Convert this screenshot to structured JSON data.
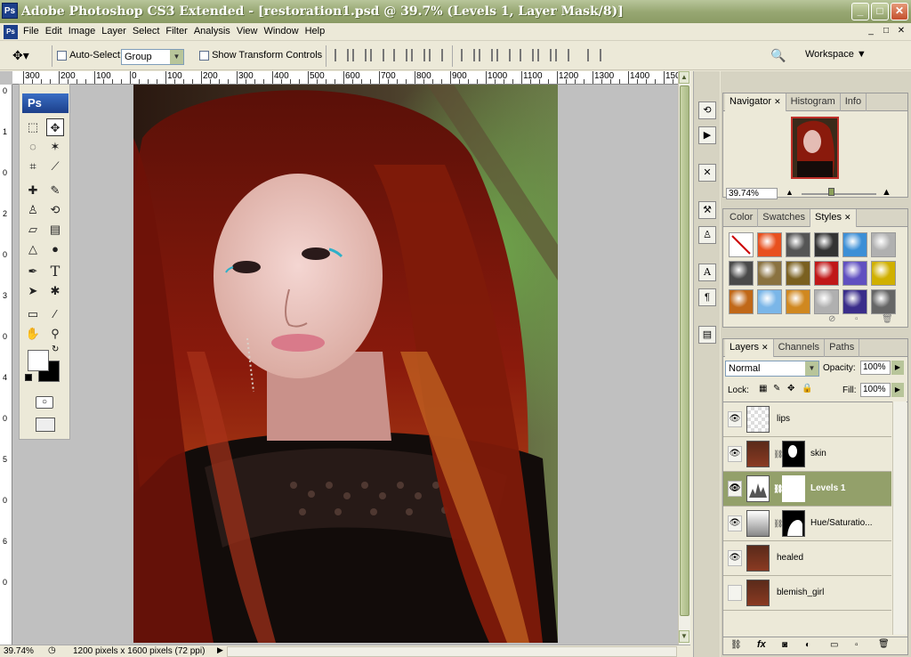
{
  "window": {
    "title": "Adobe Photoshop CS3 Extended - [restoration1.psd @ 39.7% (Levels 1, Layer Mask/8)]",
    "app_icon": "Ps",
    "minimize": "_",
    "maximize": "□",
    "close": "✕"
  },
  "menubar": {
    "items": [
      "File",
      "Edit",
      "Image",
      "Layer",
      "Select",
      "Filter",
      "Analysis",
      "View",
      "Window",
      "Help"
    ],
    "doc_controls": [
      "_",
      "□",
      "✕"
    ]
  },
  "options": {
    "auto_select_label": "Auto-Select:",
    "auto_select_value": "Group",
    "show_transform_label": "Show Transform Controls",
    "workspace_label": "Workspace"
  },
  "ruler": {
    "top_labels": [
      "300",
      "200",
      "100",
      "0",
      "100",
      "200",
      "300",
      "400",
      "500",
      "600",
      "700",
      "800",
      "900",
      "1000",
      "1100",
      "1200",
      "1300",
      "1400",
      "150"
    ],
    "left_labels": [
      "0",
      "1",
      "0",
      "2",
      "0",
      "3",
      "0",
      "4",
      "0",
      "5",
      "0",
      "6",
      "0"
    ]
  },
  "tools": {
    "logo": "Ps",
    "icons": [
      "marquee-icon",
      "move-icon",
      "lasso-icon",
      "magic-wand-icon",
      "crop-icon",
      "slice-icon",
      "healing-brush-icon",
      "brush-icon",
      "clone-stamp-icon",
      "history-brush-icon",
      "eraser-icon",
      "gradient-icon",
      "blur-icon",
      "dodge-icon",
      "pen-icon",
      "type-icon",
      "path-selection-icon",
      "shape-icon",
      "notes-icon",
      "eyedropper-icon",
      "hand-icon",
      "zoom-icon"
    ],
    "type_glyph": "T"
  },
  "status": {
    "zoom": "39.74%",
    "info": "1200 pixels x 1600 pixels (72 ppi)"
  },
  "navigator": {
    "tabs": [
      "Navigator",
      "Histogram",
      "Info"
    ],
    "zoom": "39.74%"
  },
  "styles": {
    "tabs": [
      "Color",
      "Swatches",
      "Styles"
    ],
    "swatch_colors": [
      "#ffffff",
      "#e8501e",
      "#555555",
      "#333333",
      "#3c8fd6",
      "#b0b0b0",
      "#4a4a4a",
      "#8a7240",
      "#7a6020",
      "#c01818",
      "#6050c0",
      "#d0b000",
      "#c06818",
      "#7ab6e8",
      "#d08820",
      "#b0b0b0",
      "#3a2d8a",
      "#666666"
    ]
  },
  "layers": {
    "tabs": [
      "Layers",
      "Channels",
      "Paths"
    ],
    "blend_mode": "Normal",
    "opacity_label": "Opacity:",
    "opacity_value": "100%",
    "lock_label": "Lock:",
    "fill_label": "Fill:",
    "fill_value": "100%",
    "rows": [
      {
        "name": "lips",
        "visible": true,
        "selected": false
      },
      {
        "name": "skin",
        "visible": true,
        "selected": false
      },
      {
        "name": "Levels 1",
        "visible": true,
        "selected": true
      },
      {
        "name": "Hue/Saturatio...",
        "visible": true,
        "selected": false
      },
      {
        "name": "healed",
        "visible": true,
        "selected": false
      },
      {
        "name": "blemish_girl",
        "visible": false,
        "selected": false
      }
    ],
    "footer_icons": [
      "link-icon",
      "fx-icon",
      "mask-icon",
      "adjustment-icon",
      "group-icon",
      "new-layer-icon",
      "trash-icon"
    ]
  },
  "colors": {
    "titlebar": "#98a873",
    "selected_layer": "#93a06a",
    "canvas_bg": "#c0c0c0"
  }
}
